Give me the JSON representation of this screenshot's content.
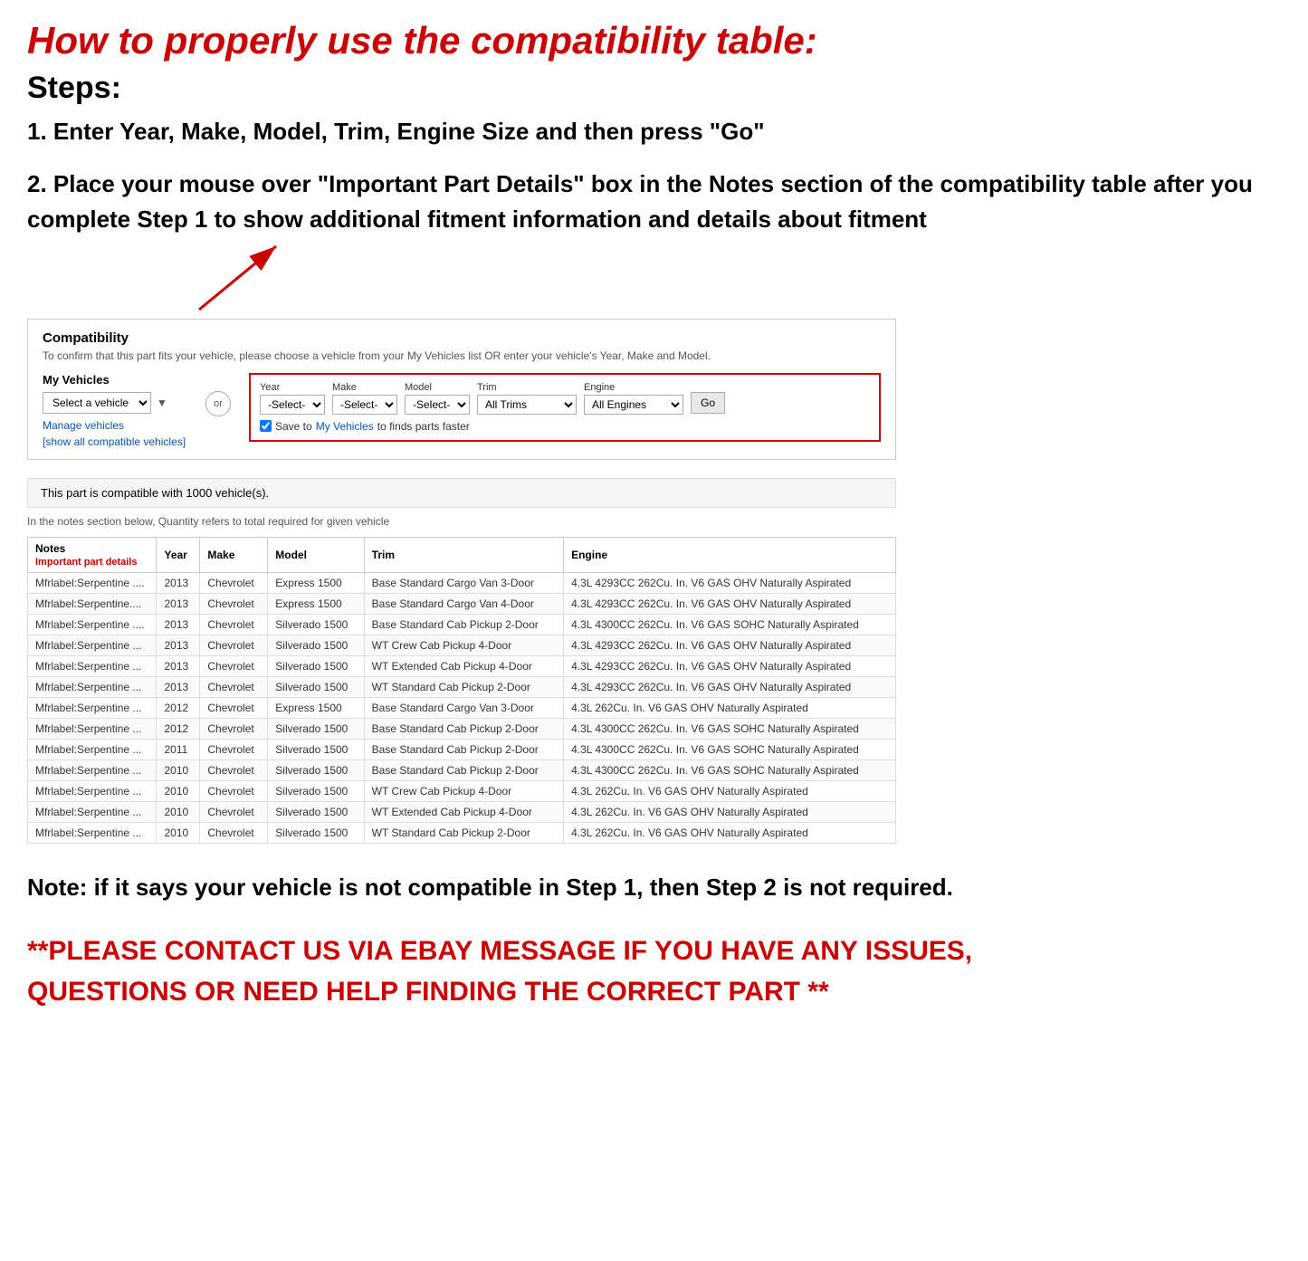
{
  "title": "How to properly use the compatibility table:",
  "steps_heading": "Steps:",
  "step1": "1. Enter Year, Make, Model, Trim, Engine Size and then press \"Go\"",
  "step2": "2. Place your mouse over \"Important Part Details\" box in the Notes section of the compatibility table after you complete Step 1 to show additional fitment information and details about fitment",
  "compat_section": {
    "title": "Compatibility",
    "subtitle": "To confirm that this part fits your vehicle, please choose a vehicle from your My Vehicles list OR enter your vehicle's Year, Make and Model.",
    "my_vehicles_label": "My Vehicles",
    "select_vehicle_placeholder": "Select a vehicle",
    "manage_vehicles": "Manage vehicles",
    "show_compatible": "[show all compatible vehicles]",
    "or_label": "or",
    "year_label": "Year",
    "year_value": "-Select-",
    "make_label": "Make",
    "make_value": "-Select-",
    "model_label": "Model",
    "model_value": "-Select-",
    "trim_label": "Trim",
    "trim_value": "All Trims",
    "engine_label": "Engine",
    "engine_value": "All Engines",
    "go_button": "Go",
    "save_text": "Save to",
    "save_link": "My Vehicles",
    "save_suffix": "to finds parts faster",
    "compatible_notice": "This part is compatible with 1000 vehicle(s).",
    "quantity_note": "In the notes section below, Quantity refers to total required for given vehicle"
  },
  "table": {
    "headers": [
      "Notes",
      "Year",
      "Make",
      "Model",
      "Trim",
      "Engine"
    ],
    "sub_header": "Important part details",
    "rows": [
      {
        "notes": "Mfrlabel:Serpentine ....",
        "year": "2013",
        "make": "Chevrolet",
        "model": "Express 1500",
        "trim": "Base Standard Cargo Van 3-Door",
        "engine": "4.3L 4293CC 262Cu. In. V6 GAS OHV Naturally Aspirated"
      },
      {
        "notes": "Mfrlabel:Serpentine....",
        "year": "2013",
        "make": "Chevrolet",
        "model": "Express 1500",
        "trim": "Base Standard Cargo Van 4-Door",
        "engine": "4.3L 4293CC 262Cu. In. V6 GAS OHV Naturally Aspirated"
      },
      {
        "notes": "Mfrlabel:Serpentine ....",
        "year": "2013",
        "make": "Chevrolet",
        "model": "Silverado 1500",
        "trim": "Base Standard Cab Pickup 2-Door",
        "engine": "4.3L 4300CC 262Cu. In. V6 GAS SOHC Naturally Aspirated"
      },
      {
        "notes": "Mfrlabel:Serpentine ...",
        "year": "2013",
        "make": "Chevrolet",
        "model": "Silverado 1500",
        "trim": "WT Crew Cab Pickup 4-Door",
        "engine": "4.3L 4293CC 262Cu. In. V6 GAS OHV Naturally Aspirated"
      },
      {
        "notes": "Mfrlabel:Serpentine ...",
        "year": "2013",
        "make": "Chevrolet",
        "model": "Silverado 1500",
        "trim": "WT Extended Cab Pickup 4-Door",
        "engine": "4.3L 4293CC 262Cu. In. V6 GAS OHV Naturally Aspirated"
      },
      {
        "notes": "Mfrlabel:Serpentine ...",
        "year": "2013",
        "make": "Chevrolet",
        "model": "Silverado 1500",
        "trim": "WT Standard Cab Pickup 2-Door",
        "engine": "4.3L 4293CC 262Cu. In. V6 GAS OHV Naturally Aspirated"
      },
      {
        "notes": "Mfrlabel:Serpentine ...",
        "year": "2012",
        "make": "Chevrolet",
        "model": "Express 1500",
        "trim": "Base Standard Cargo Van 3-Door",
        "engine": "4.3L 262Cu. In. V6 GAS OHV Naturally Aspirated"
      },
      {
        "notes": "Mfrlabel:Serpentine ...",
        "year": "2012",
        "make": "Chevrolet",
        "model": "Silverado 1500",
        "trim": "Base Standard Cab Pickup 2-Door",
        "engine": "4.3L 4300CC 262Cu. In. V6 GAS SOHC Naturally Aspirated"
      },
      {
        "notes": "Mfrlabel:Serpentine ...",
        "year": "2011",
        "make": "Chevrolet",
        "model": "Silverado 1500",
        "trim": "Base Standard Cab Pickup 2-Door",
        "engine": "4.3L 4300CC 262Cu. In. V6 GAS SOHC Naturally Aspirated"
      },
      {
        "notes": "Mfrlabel:Serpentine ...",
        "year": "2010",
        "make": "Chevrolet",
        "model": "Silverado 1500",
        "trim": "Base Standard Cab Pickup 2-Door",
        "engine": "4.3L 4300CC 262Cu. In. V6 GAS SOHC Naturally Aspirated"
      },
      {
        "notes": "Mfrlabel:Serpentine ...",
        "year": "2010",
        "make": "Chevrolet",
        "model": "Silverado 1500",
        "trim": "WT Crew Cab Pickup 4-Door",
        "engine": "4.3L 262Cu. In. V6 GAS OHV Naturally Aspirated"
      },
      {
        "notes": "Mfrlabel:Serpentine ...",
        "year": "2010",
        "make": "Chevrolet",
        "model": "Silverado 1500",
        "trim": "WT Extended Cab Pickup 4-Door",
        "engine": "4.3L 262Cu. In. V6 GAS OHV Naturally Aspirated"
      },
      {
        "notes": "Mfrlabel:Serpentine ...",
        "year": "2010",
        "make": "Chevrolet",
        "model": "Silverado 1500",
        "trim": "WT Standard Cab Pickup 2-Door",
        "engine": "4.3L 262Cu. In. V6 GAS OHV Naturally Aspirated"
      }
    ]
  },
  "note_text": "Note: if it says your vehicle is not compatible in Step 1, then Step 2 is not required.",
  "contact_text": "**PLEASE CONTACT US VIA EBAY MESSAGE IF YOU HAVE ANY ISSUES, QUESTIONS OR NEED HELP FINDING THE CORRECT PART **"
}
